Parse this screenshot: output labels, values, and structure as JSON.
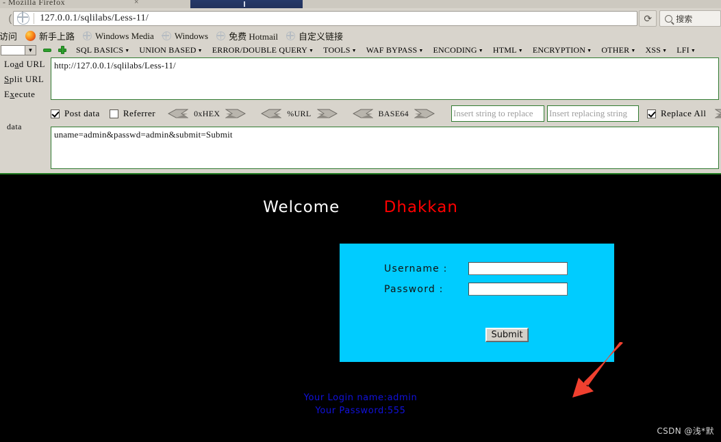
{
  "browser": {
    "tab_title_partial": "- Mozilla Firefox",
    "url": "127.0.0.1/sqlilabs/Less-11/",
    "reload_icon": "reload-icon",
    "search_placeholder": "搜索",
    "search_icon": "search-icon",
    "bookmarks": [
      {
        "label": "常访问",
        "icon": "globe-icon"
      },
      {
        "label": "新手上路",
        "icon": "firefox-icon"
      },
      {
        "label": "Windows Media",
        "icon": "globe-icon"
      },
      {
        "label": "Windows",
        "icon": "globe-icon"
      },
      {
        "label": "免费 Hotmail",
        "icon": "globe-icon"
      },
      {
        "label": "自定义链接",
        "icon": "globe-icon"
      }
    ]
  },
  "hackbar": {
    "select_value": "",
    "remove_icon": "minus-icon",
    "add_icon": "plus-icon",
    "menus": [
      "SQL BASICS",
      "UNION BASED",
      "ERROR/DOUBLE QUERY",
      "TOOLS",
      "WAF BYPASS",
      "ENCODING",
      "HTML",
      "ENCRYPTION",
      "OTHER",
      "XSS",
      "LFI"
    ],
    "buttons": {
      "load_url": "Load URL",
      "split_url": "Split URL",
      "execute": "Execute",
      "data_label": "data"
    },
    "url_value": "http://127.0.0.1/sqlilabs/Less-11/",
    "post_data_value": "uname=admin&passwd=admin&submit=Submit",
    "post_data_label": "Post data",
    "post_data_checked": "true",
    "referrer_label": "Referrer",
    "referrer_checked": "false",
    "encoders": [
      "0xHEX",
      "%URL",
      "BASE64"
    ],
    "replace_search_placeholder": "Insert string to replace",
    "replace_with_placeholder": "Insert replacing string",
    "replace_all_label": "Replace All",
    "replace_all_checked": "true"
  },
  "page": {
    "welcome": "Welcome",
    "brand": "Dhakkan",
    "form": {
      "username_label": "Username :",
      "password_label": "Password :",
      "username_value": "",
      "password_value": "",
      "submit_label": "Submit"
    },
    "result_line1": "Your Login name:admin",
    "result_line2": "Your Password:555",
    "watermark": "CSDN @浅*默"
  },
  "colors": {
    "form_background": "#00ccff",
    "brand_text": "#ff0000",
    "result_text": "#1111dd",
    "arrow": "#f0402f",
    "hackbar_border": "#2f7a2f",
    "chrome_background": "#d8d4cc"
  }
}
